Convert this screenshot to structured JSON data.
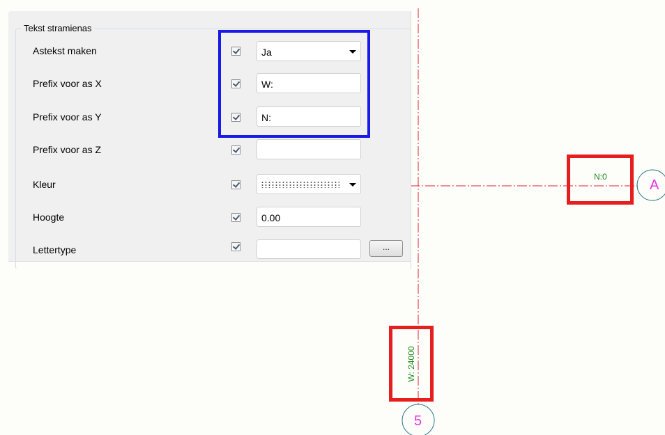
{
  "panel": {
    "group_title": "Tekst stramienas",
    "rows": [
      {
        "label": "Astekst maken",
        "checked": true,
        "value": "Ja",
        "control": "combo"
      },
      {
        "label": "Prefix voor as X",
        "checked": true,
        "value": "W:",
        "control": "text"
      },
      {
        "label": "Prefix voor as Y",
        "checked": true,
        "value": "N:",
        "control": "text"
      },
      {
        "label": "Prefix voor as Z",
        "checked": true,
        "value": "",
        "control": "text"
      },
      {
        "label": "Kleur",
        "checked": true,
        "value": "",
        "control": "color-combo"
      },
      {
        "label": "Hoogte",
        "checked": true,
        "value": "0.00",
        "control": "text"
      },
      {
        "label": "Lettertype",
        "checked": true,
        "value": "",
        "control": "text-browse"
      }
    ],
    "browse_label": "..."
  },
  "drawing": {
    "horizontal_axis_text": "N:0",
    "vertical_axis_text": "W: 24000",
    "bubble_horizontal": "A",
    "bubble_vertical": "5"
  },
  "colors": {
    "axis_line": "#e0243a",
    "axis_text": "#1f8a1f",
    "bubble_text": "#e632e6",
    "bubble_circle": "#2a7a8a",
    "highlight_blue": "#1a1ae6",
    "highlight_red": "#e61e1e"
  }
}
